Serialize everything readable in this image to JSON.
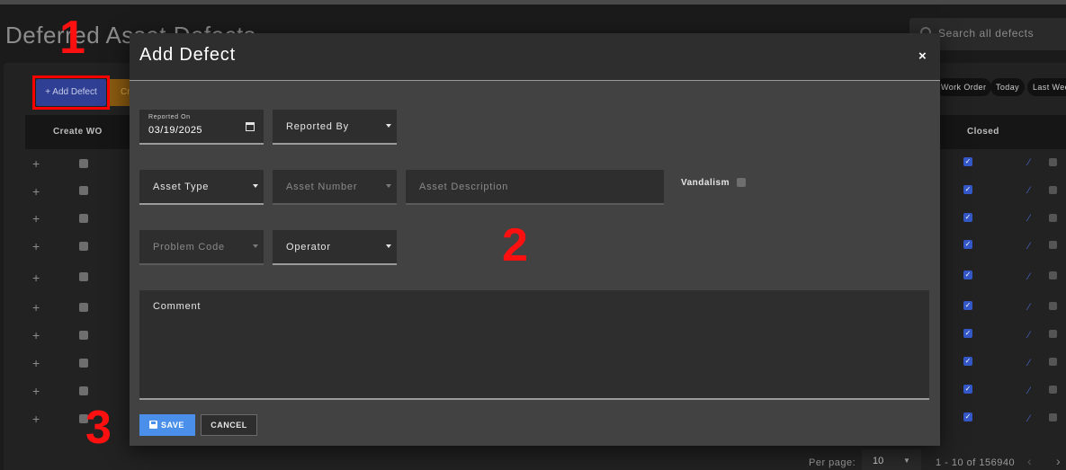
{
  "page": {
    "title": "Deferred Asset Defects",
    "search_placeholder": "Search all defects",
    "add_defect_label": "+ Add Defect",
    "orange_button_label": "Cr",
    "filter_chips": [
      "Work Order",
      "Today",
      "Last Week"
    ]
  },
  "table": {
    "columns": [
      "Create WO",
      "Closed"
    ],
    "row_count_visible": 10
  },
  "footer": {
    "per_page_label": "Per page:",
    "per_page_value": "10",
    "range_text": "1 - 10 of 156940"
  },
  "modal": {
    "title": "Add Defect",
    "close_label": "×",
    "reported_on_label": "Reported On",
    "reported_on_value": "03/19/2025",
    "reported_by_label": "Reported By",
    "asset_type_label": "Asset Type",
    "asset_number_label": "Asset Number",
    "asset_description_label": "Asset Description",
    "vandalism_label": "Vandalism",
    "problem_code_label": "Problem Code",
    "operator_label": "Operator",
    "comment_label": "Comment",
    "save_label": "SAVE",
    "cancel_label": "CANCEL"
  },
  "annotations": [
    "1",
    "2",
    "3"
  ],
  "colors": {
    "accent": "#4a90ea",
    "add_button": "#2f3f93",
    "highlight": "#ff0000"
  }
}
